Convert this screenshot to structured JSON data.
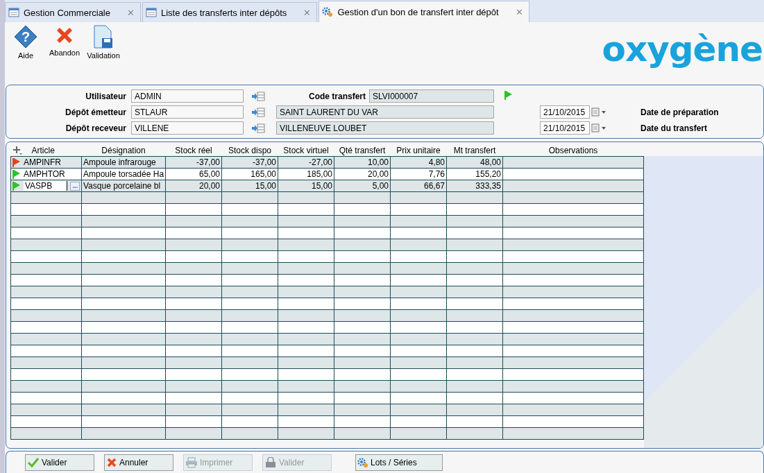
{
  "tabs": [
    {
      "label": "Gestion Commerciale",
      "kind": "list",
      "selected": false,
      "close": "✕"
    },
    {
      "label": "Liste des transferts inter dépôts",
      "kind": "list",
      "selected": false,
      "close": "✕"
    },
    {
      "label": "Gestion d'un bon de transfert inter dépôt",
      "kind": "gear",
      "selected": true,
      "close": "✕"
    }
  ],
  "toolbar": [
    {
      "kind": "help",
      "label": "Aide",
      "glyph": "?"
    },
    {
      "kind": "cancel",
      "label": "Abandon"
    },
    {
      "kind": "save",
      "label": "Validation"
    }
  ],
  "logo": "oxygène",
  "form": {
    "user": {
      "label": "Utilisateur",
      "value": "ADMIN"
    },
    "code": {
      "label": "Code transfert",
      "value": "SLVI000007"
    },
    "sender": {
      "label": "Dépôt émetteur",
      "code": "STLAUR",
      "name": "SAINT LAURENT DU VAR",
      "date": "21/10/2015",
      "date_label": "Date de préparation"
    },
    "receiver": {
      "label": "Dépôt receveur",
      "code": "VILLENE",
      "name": "VILLENEUVE LOUBET",
      "date": "21/10/2015",
      "date_label": "Date du transfert"
    }
  },
  "grid": {
    "columns": [
      "Article",
      "Désignation",
      "Stock réel",
      "Stock dispo",
      "Stock virtuel",
      "Qté transfert",
      "Prix unitaire",
      "Mt transfert",
      "Observations"
    ],
    "lookup_label": "...",
    "rows": [
      {
        "color": "#e0451f",
        "editing": false,
        "cells": [
          "AMPINFR",
          "Ampoule infrarouge",
          "-37,00",
          "-37,00",
          "-27,00",
          "10,00",
          "4,80",
          "48,00"
        ]
      },
      {
        "color": "#2cc22c",
        "editing": false,
        "cells": [
          "AMPHTOR",
          "Ampoule torsadée Ha",
          "65,00",
          "165,00",
          "185,00",
          "20,00",
          "7,76",
          "155,20"
        ]
      },
      {
        "color": "#2cc22c",
        "editing": true,
        "cells": [
          "VASPB",
          "Vasque porcelaine bl",
          "20,00",
          "15,00",
          "15,00",
          "5,00",
          "66,67",
          "333,35"
        ]
      }
    ]
  },
  "buttons": [
    {
      "kind": "check",
      "label": "Valider",
      "disabled": false
    },
    {
      "kind": "cross",
      "label": "Annuler",
      "disabled": false
    },
    {
      "kind": "print",
      "label": "Imprimer",
      "disabled": true
    },
    {
      "kind": "lock",
      "label": "Valider",
      "disabled": true
    },
    {
      "kind": "gear",
      "label": "Lots / Séries",
      "disabled": false
    }
  ]
}
